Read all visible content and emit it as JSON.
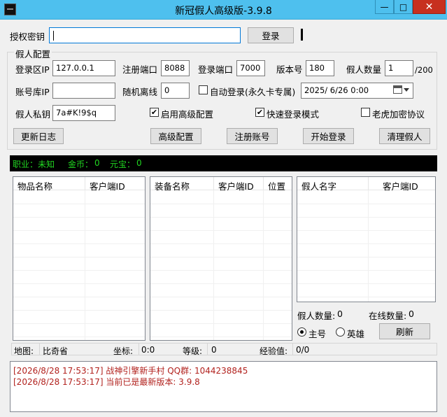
{
  "window": {
    "title": "新冠假人高级版-3.9.8",
    "minimize": "—",
    "maximize": "□",
    "close": "✕"
  },
  "auth": {
    "label": "授权密钥",
    "value": "",
    "login_button": "登录"
  },
  "config": {
    "group_title": "假人配置",
    "login_zone_ip_label": "登录区IP",
    "login_zone_ip": "127.0.0.1",
    "register_port_label": "注册端口",
    "register_port": "8088",
    "login_port_label": "登录端口",
    "login_port": "7000",
    "version_label": "版本号",
    "version": "180",
    "bot_count_label": "假人数量",
    "bot_count": "1",
    "bot_count_max": "/200",
    "account_db_ip_label": "账号库IP",
    "account_db_ip": "",
    "random_offline_label": "随机离线",
    "random_offline": "0",
    "auto_login_label": "自动登录(永久卡专属)",
    "auto_login_checked": false,
    "datetime": "2025/  6/26   0:00",
    "private_key_label": "假人私钥",
    "private_key": "7a#K!9$q",
    "advanced_config_label": "启用高级配置",
    "advanced_config_checked": true,
    "fast_login_label": "快速登录模式",
    "fast_login_checked": true,
    "tiger_protocol_label": "老虎加密协议",
    "tiger_protocol_checked": false
  },
  "buttons": {
    "update_log": "更新日志",
    "advanced_config": "高级配置",
    "register_account": "注册账号",
    "start_login": "开始登录",
    "clear_bots": "清理假人"
  },
  "info_bar": {
    "job_label": "职业：",
    "job": "未知",
    "gold_label": "金币：",
    "gold": "0",
    "yuanbao_label": "元宝：",
    "yuanbao": "0"
  },
  "items_table": {
    "headers": [
      "物品名称",
      "客户端ID"
    ]
  },
  "equip_table": {
    "headers": [
      "装备名称",
      "客户端ID",
      "位置"
    ]
  },
  "bots_table": {
    "headers": [
      "假人名字",
      "客户端ID"
    ]
  },
  "bot_stats": {
    "count_label": "假人数量:",
    "count": "0",
    "online_label": "在线数量:",
    "online": "0"
  },
  "mode": {
    "main_label": "主号",
    "hero_label": "英雄",
    "selected": "main",
    "refresh_button": "刷新"
  },
  "status": {
    "map_label": "地图:",
    "map": "比奇省",
    "coord_label": "坐标:",
    "coord": "0:0",
    "level_label": "等级:",
    "level": "0",
    "exp_label": "经验值:",
    "exp": "0/0"
  },
  "log": [
    "[2026/8/28 17:53:17] 战神引擎新手村 QQ群: 1044238845",
    "[2026/8/28 17:53:17] 当前已是最新版本: 3.9.8"
  ]
}
